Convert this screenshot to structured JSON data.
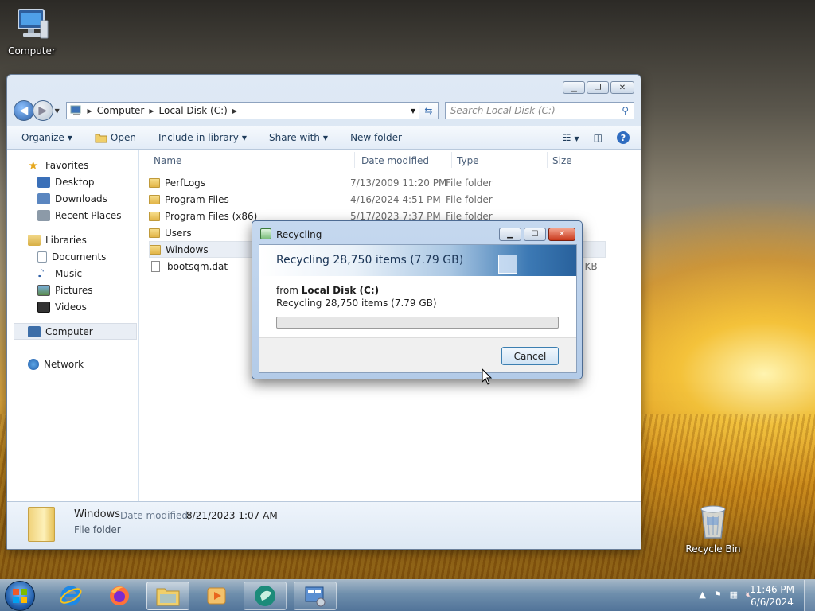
{
  "desktop": {
    "icons": [
      {
        "label": "Computer"
      },
      {
        "label": "Recycle Bin"
      }
    ]
  },
  "explorer": {
    "breadcrumb": [
      "Computer",
      "Local Disk (C:)"
    ],
    "search_placeholder": "Search Local Disk (C:)",
    "toolbar": {
      "organize": "Organize",
      "open": "Open",
      "include_in_library": "Include in library",
      "share_with": "Share with",
      "new_folder": "New folder"
    },
    "nav": {
      "favorites": "Favorites",
      "favorites_items": [
        "Desktop",
        "Downloads",
        "Recent Places"
      ],
      "libraries": "Libraries",
      "libraries_items": [
        "Documents",
        "Music",
        "Pictures",
        "Videos"
      ],
      "computer": "Computer",
      "network": "Network"
    },
    "columns": {
      "name": "Name",
      "date": "Date modified",
      "type": "Type",
      "size": "Size"
    },
    "files": [
      {
        "name": "PerfLogs",
        "date": "7/13/2009 11:20 PM",
        "type": "File folder",
        "size": ""
      },
      {
        "name": "Program Files",
        "date": "4/16/2024 4:51 PM",
        "type": "File folder",
        "size": ""
      },
      {
        "name": "Program Files (x86)",
        "date": "5/17/2023 7:37 PM",
        "type": "File folder",
        "size": ""
      },
      {
        "name": "Users",
        "date": "",
        "type": "",
        "size": ""
      },
      {
        "name": "Windows",
        "date": "",
        "type": "",
        "size": ""
      },
      {
        "name": "bootsqm.dat",
        "date": "",
        "type": "",
        "size": "4 KB"
      }
    ],
    "details": {
      "name": "Windows",
      "modified_label": "Date modified:",
      "modified_value": "8/21/2023 1:07 AM",
      "type": "File folder"
    }
  },
  "dialog": {
    "title": "Recycling",
    "headline": "Recycling 28,750 items (7.79 GB)",
    "from_prefix": "from",
    "from_location": "Local Disk (C:)",
    "status": "Recycling 28,750 items (7.79 GB)",
    "progress": 0,
    "cancel": "Cancel"
  },
  "taskbar": {
    "time": "11:46 PM",
    "date": "6/6/2024"
  }
}
